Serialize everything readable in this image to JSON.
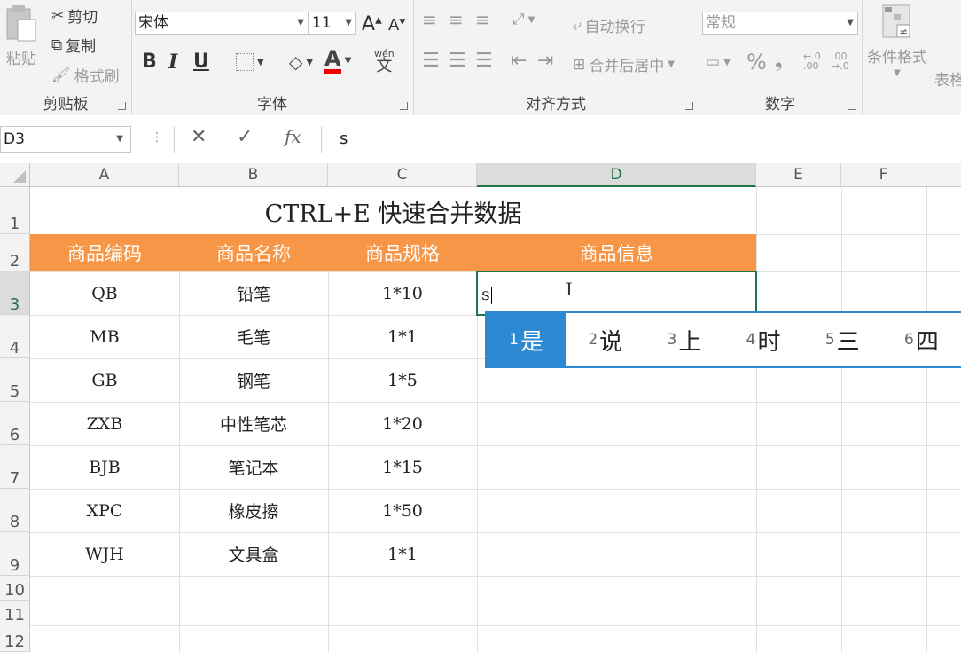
{
  "ribbon": {
    "clipboard": {
      "label": "剪贴板",
      "paste": "粘贴",
      "cut": "剪切",
      "copy": "复制",
      "format_painter": "格式刷"
    },
    "font": {
      "label": "字体",
      "font_name": "宋体",
      "font_size": "11",
      "grow": "A",
      "shrink": "A",
      "bold": "B",
      "italic": "I",
      "underline": "U",
      "font_color": "A",
      "phonetic_top": "wén",
      "phonetic": "文"
    },
    "alignment": {
      "label": "对齐方式",
      "wrap_text": "自动换行",
      "merge_center": "合并后居中"
    },
    "number": {
      "label": "数字",
      "format": "常规",
      "percent": "%",
      "comma": "❟",
      "inc_decimal": "←.0 .00",
      "dec_decimal": ".00 →.0"
    },
    "styles": {
      "conditional_format": "条件格式",
      "table_format": "表格"
    }
  },
  "formula_bar": {
    "name_box": "D3",
    "cancel": "✕",
    "enter": "✓",
    "fx": "fx",
    "content": "s"
  },
  "columns": [
    "A",
    "B",
    "C",
    "D",
    "E",
    "F"
  ],
  "rows": [
    "1",
    "2",
    "3",
    "4",
    "5",
    "6",
    "7",
    "8",
    "9",
    "10",
    "11",
    "12"
  ],
  "sheet": {
    "title": "CTRL+E 快速合并数据",
    "headers": [
      "商品编码",
      "商品名称",
      "商品规格",
      "商品信息"
    ],
    "data": [
      [
        "QB",
        "铅笔",
        "1*10"
      ],
      [
        "MB",
        "毛笔",
        "1*1"
      ],
      [
        "GB",
        "钢笔",
        "1*5"
      ],
      [
        "ZXB",
        "中性笔芯",
        "1*20"
      ],
      [
        "BJB",
        "笔记本",
        "1*15"
      ],
      [
        "XPC",
        "橡皮擦",
        "1*50"
      ],
      [
        "WJH",
        "文具盒",
        "1*1"
      ]
    ],
    "editing_value": "s"
  },
  "ime": {
    "candidates": [
      {
        "num": "1",
        "text": "是"
      },
      {
        "num": "2",
        "text": "说"
      },
      {
        "num": "3",
        "text": "上"
      },
      {
        "num": "4",
        "text": "时"
      },
      {
        "num": "5",
        "text": "三"
      },
      {
        "num": "6",
        "text": "四"
      }
    ]
  },
  "colors": {
    "header_fill": "#f79646",
    "accent": "#217346",
    "ime_blue": "#2d89d1"
  }
}
